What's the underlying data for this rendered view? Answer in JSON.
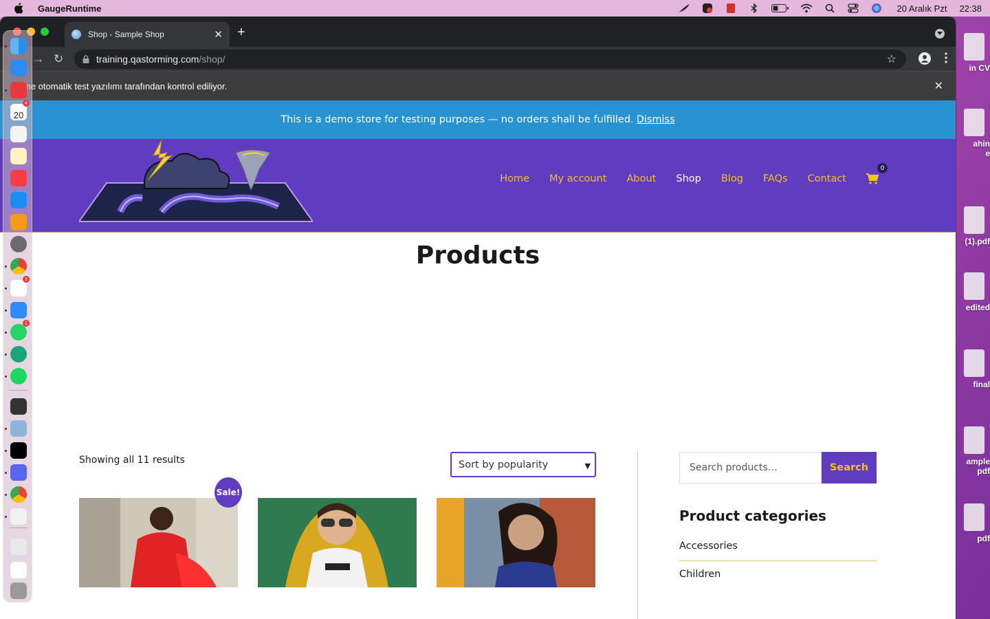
{
  "menubar": {
    "app_name": "GaugeRuntime",
    "date": "20 Aralık Pzt",
    "time": "22:38"
  },
  "desktop_files": [
    "in CV",
    "ahin\ne",
    "(1).pdf",
    "edited",
    "final",
    "ample\npdf",
    "pdf"
  ],
  "browser": {
    "tab_title": "Shop - Sample Shop",
    "url_host": "training.qastorming.com",
    "url_path": "/shop/",
    "automation_notice": "me otomatik test yazılımı tarafından kontrol ediliyor."
  },
  "store_notice": {
    "text": "This is a demo store for testing purposes — no orders shall be fulfilled.",
    "dismiss": "Dismiss"
  },
  "nav": {
    "items": [
      "Home",
      "My account",
      "About",
      "Shop",
      "Blog",
      "FAQs",
      "Contact"
    ],
    "active": "Shop",
    "cart_count": "0"
  },
  "main": {
    "title": "Products",
    "results": "Showing all 11 results",
    "sort_selected": "Sort by popularity",
    "sale_badge": "Sale!"
  },
  "sidebar": {
    "search_placeholder": "Search products…",
    "search_button": "Search",
    "categories_heading": "Product categories",
    "categories": [
      "Accessories",
      "Children"
    ]
  },
  "colors": {
    "brand_purple": "#5f3cc0",
    "accent_yellow": "#f4c21c",
    "notice_blue": "#2793d1"
  },
  "dock": {
    "badges": {
      "calendar": "4",
      "slack": "3",
      "whatsapp": "1"
    },
    "calendar_day": "20"
  }
}
